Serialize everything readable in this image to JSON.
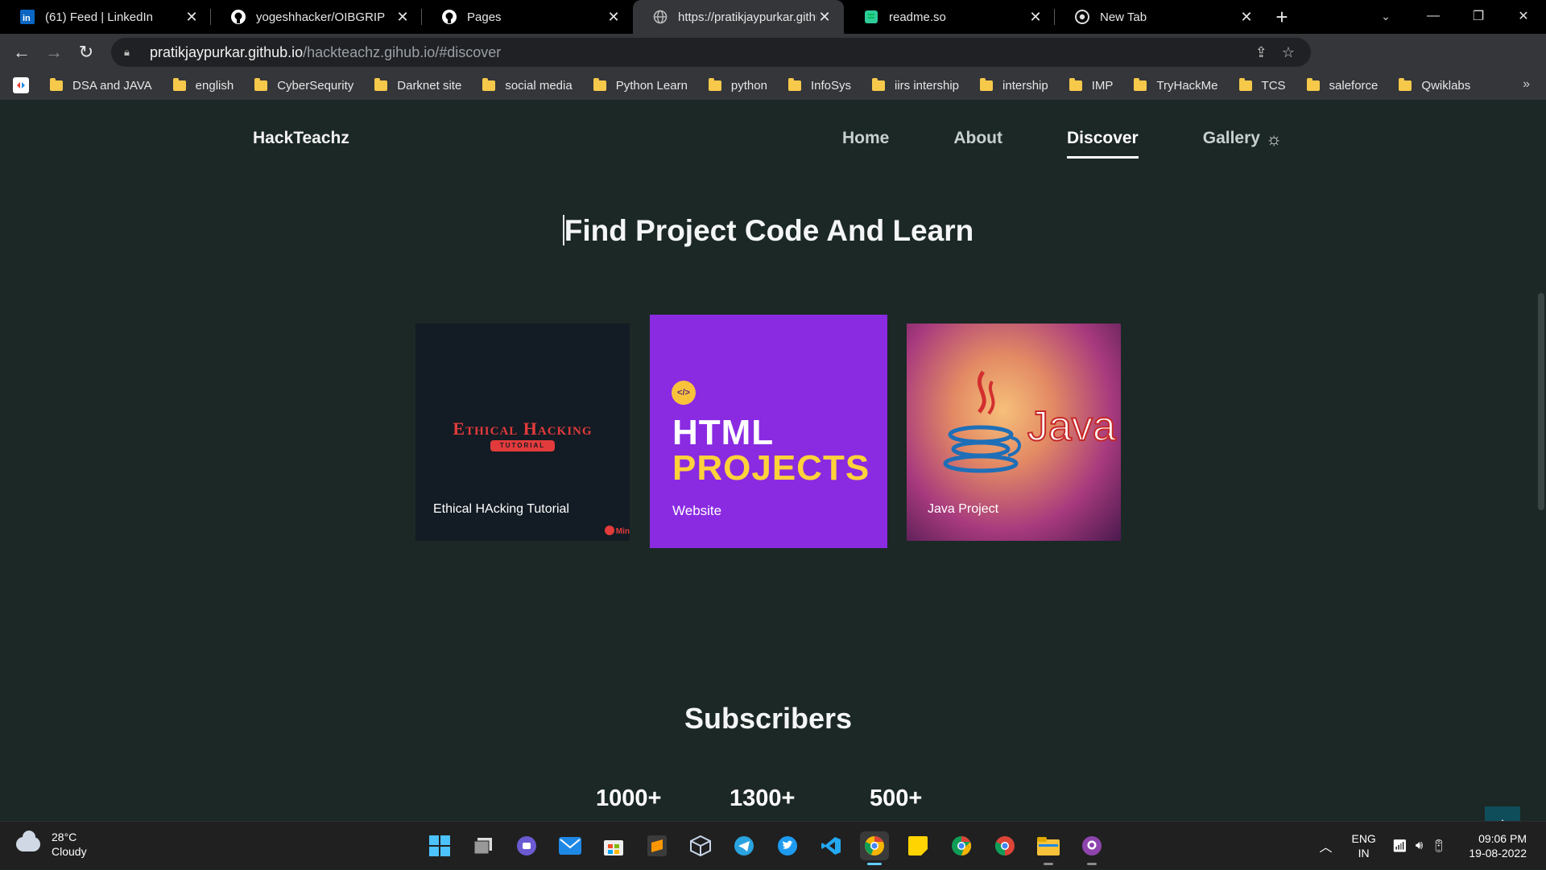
{
  "browser": {
    "tabs": [
      {
        "title": "(61) Feed | LinkedIn",
        "favicon": "linkedin-icon",
        "active": false
      },
      {
        "title": "yogeshhacker/OIBGRIP",
        "favicon": "github-icon",
        "active": false
      },
      {
        "title": "Pages",
        "favicon": "github-icon",
        "active": false
      },
      {
        "title": "https://pratikjaypurkar.githu",
        "favicon": "globe-icon",
        "active": true
      },
      {
        "title": "readme.so",
        "favicon": "readme-icon",
        "active": false
      },
      {
        "title": "New Tab",
        "favicon": "chrome-icon",
        "active": false
      }
    ],
    "url_host": "pratikjaypurkar.github.io",
    "url_path": "/hackteachz.gihub.io/#discover",
    "bookmarks": [
      "DSA and JAVA",
      "english",
      "CyberSequrity",
      "Darknet site",
      "social media",
      "Python Learn",
      "python",
      "InfoSys",
      "iirs intership",
      "intership",
      "IMP",
      "TryHackMe",
      "TCS",
      "saleforce",
      "Qwiklabs"
    ],
    "overflow_label": "»"
  },
  "site": {
    "brand": "HackTeachz",
    "nav": [
      {
        "label": "Home",
        "active": false
      },
      {
        "label": "About",
        "active": false
      },
      {
        "label": "Discover",
        "active": true
      },
      {
        "label": "Gallery",
        "active": false
      }
    ],
    "theme_toggle_icon": "sun-icon",
    "heading": "Find Project Code And Learn",
    "cards": {
      "ethical": {
        "art_title": "Ethical Hacking",
        "art_badge": "TUTORIAL",
        "label": "Ethical HAcking Tutorial",
        "watermark": "Min"
      },
      "html": {
        "icon_text": "</>",
        "line1": "HTML",
        "line2": "PROJECTS",
        "label": "Website"
      },
      "java": {
        "logo_text": "Java",
        "label": "Java Project"
      }
    },
    "subscribers_title": "Subscribers",
    "stats": [
      "1000+",
      "1300+",
      "500+"
    ],
    "scroll_top_icon": "arrow-up-icon"
  },
  "taskbar": {
    "weather_temp": "28°C",
    "weather_desc": "Cloudy",
    "lang_line1": "ENG",
    "lang_line2": "IN",
    "time": "09:06 PM",
    "date": "19-08-2022"
  },
  "colors": {
    "page_bg": "#1c2826",
    "accent_purple": "#8a2be2",
    "accent_yellow": "#ffd23a",
    "scroll_button": "#0f4d5a"
  }
}
